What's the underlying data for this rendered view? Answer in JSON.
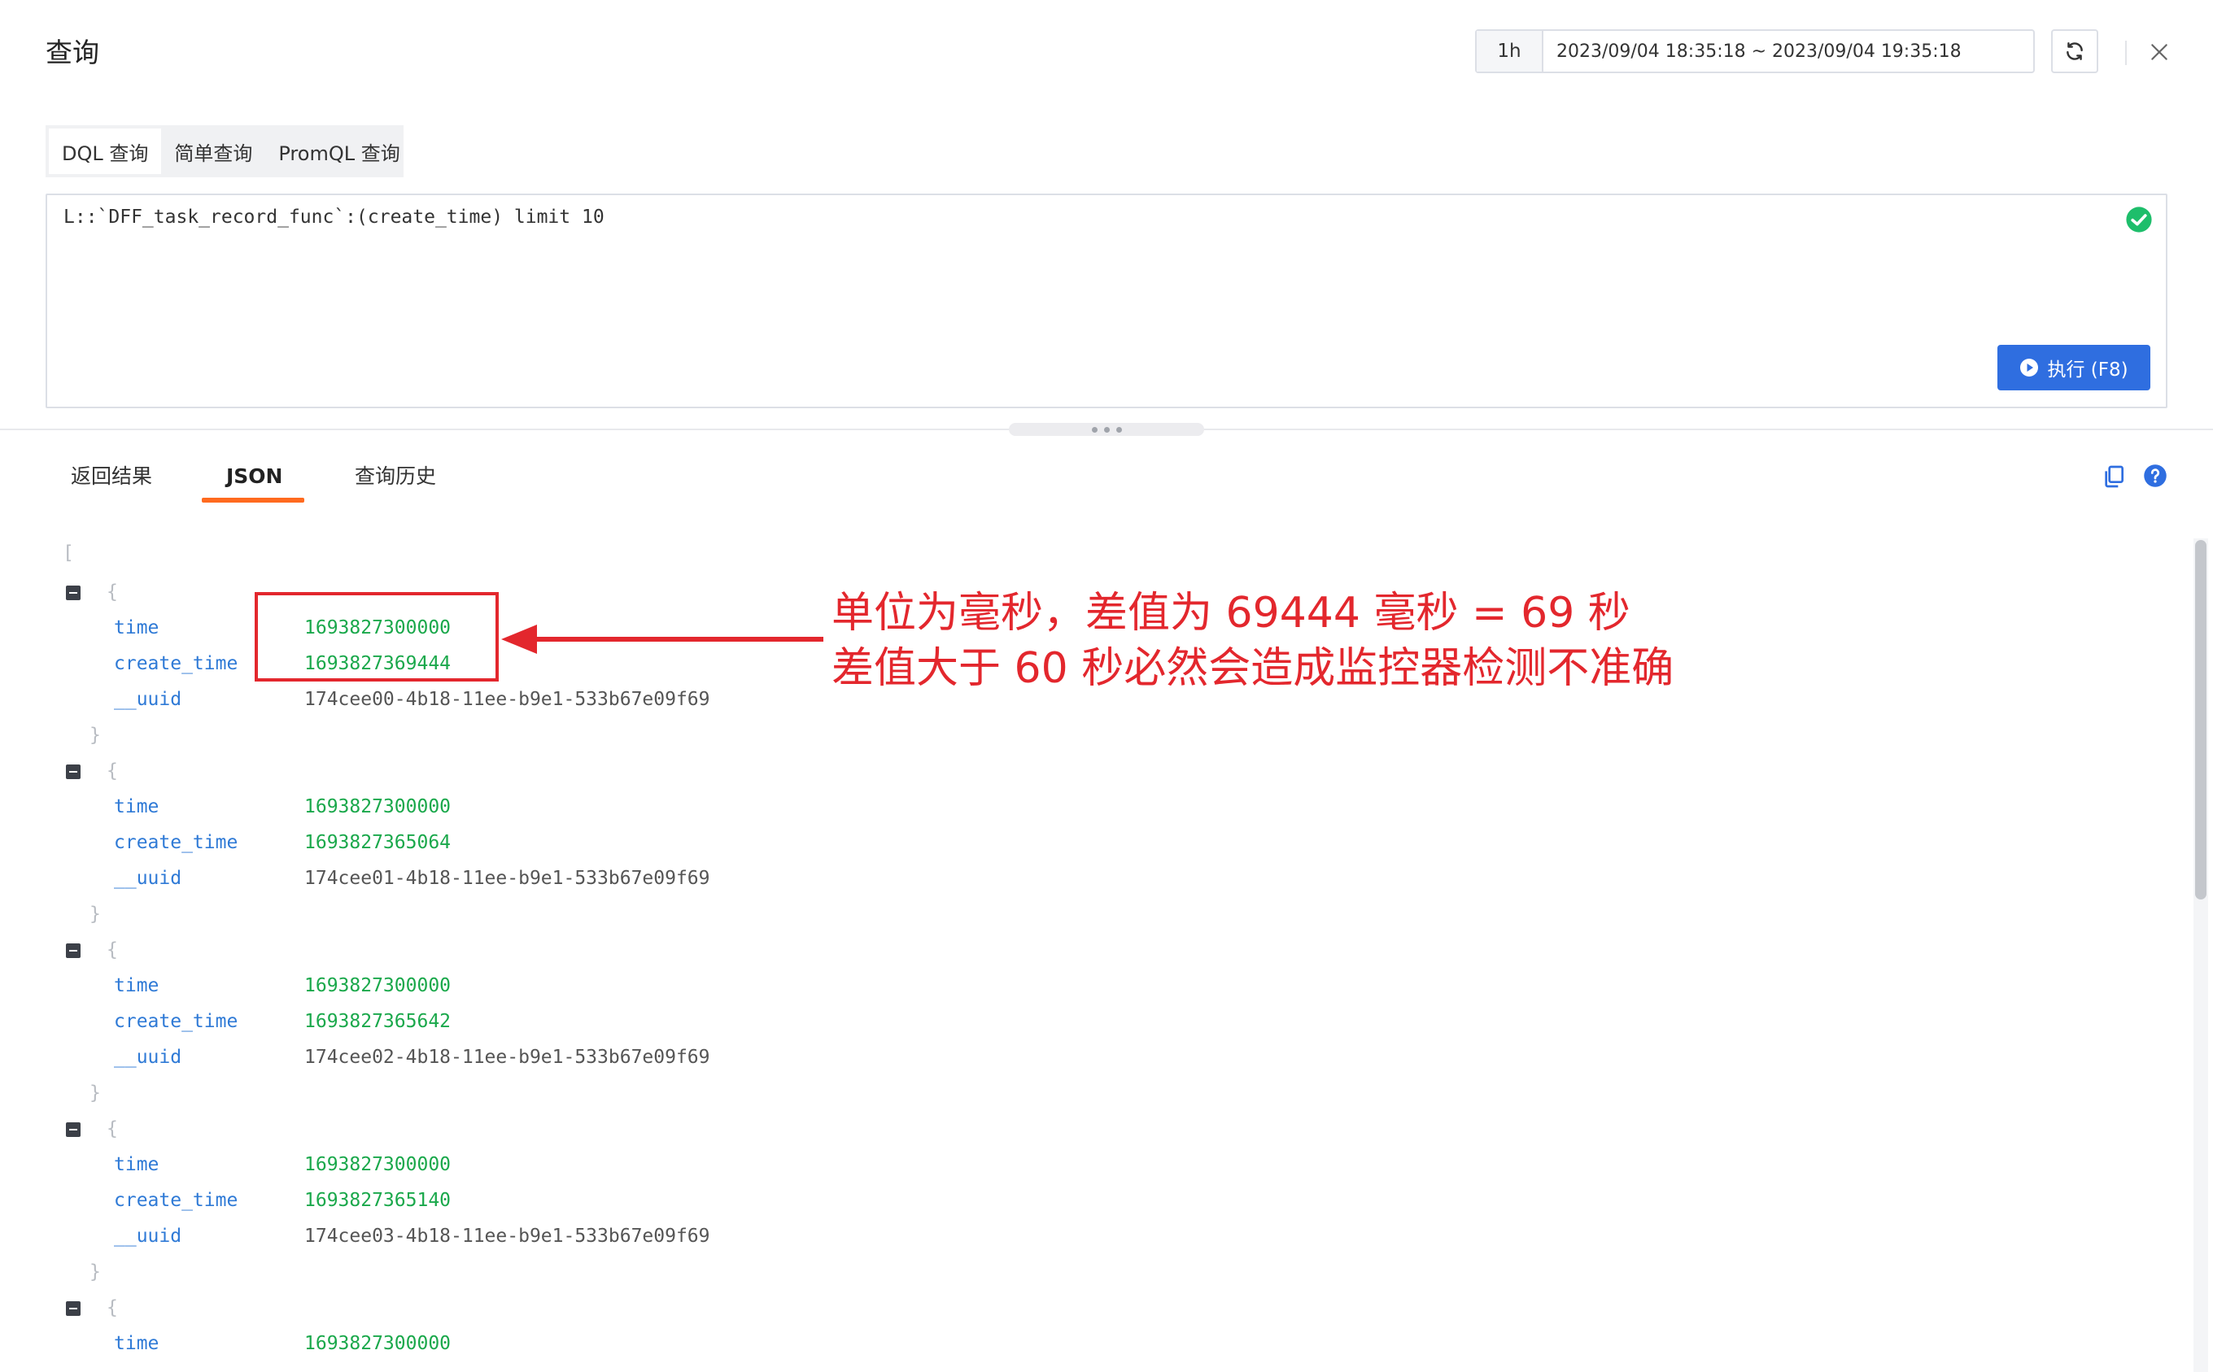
{
  "header": {
    "title": "查询",
    "time_quick": "1h",
    "time_range": "2023/09/04 18:35:18 ~ 2023/09/04 19:35:18"
  },
  "query_tabs": [
    {
      "label": "DQL 查询",
      "active": true
    },
    {
      "label": "简单查询",
      "active": false
    },
    {
      "label": "PromQL 查询",
      "active": false
    }
  ],
  "editor": {
    "query": "L::`DFF_task_record_func`:(create_time) limit 10",
    "run_label": "执行 (F8)"
  },
  "result_tabs": [
    {
      "label": "返回结果",
      "active": false
    },
    {
      "label": "JSON",
      "active": true
    },
    {
      "label": "查询历史",
      "active": false
    }
  ],
  "json": {
    "open_bracket": "[",
    "records": [
      {
        "time": "1693827300000",
        "create_time": "1693827369444",
        "__uuid": "174cee00-4b18-11ee-b9e1-533b67e09f69"
      },
      {
        "time": "1693827300000",
        "create_time": "1693827365064",
        "__uuid": "174cee01-4b18-11ee-b9e1-533b67e09f69"
      },
      {
        "time": "1693827300000",
        "create_time": "1693827365642",
        "__uuid": "174cee02-4b18-11ee-b9e1-533b67e09f69"
      },
      {
        "time": "1693827300000",
        "create_time": "1693827365140",
        "__uuid": "174cee03-4b18-11ee-b9e1-533b67e09f69"
      },
      {
        "time": "1693827300000",
        "create_time": "",
        "__uuid": ""
      }
    ]
  },
  "annotation": {
    "line1": "单位为毫秒，差值为 69444 毫秒 = 69 秒",
    "line2": "差值大于 60 秒必然会造成监控器检测不准确",
    "color": "#e3272d"
  },
  "colors": {
    "accent_orange": "#ff6a1f",
    "primary_blue": "#2f6ee0",
    "json_key": "#2f7ad6",
    "json_number": "#1aa84b",
    "success_green": "#1ebe6b"
  }
}
